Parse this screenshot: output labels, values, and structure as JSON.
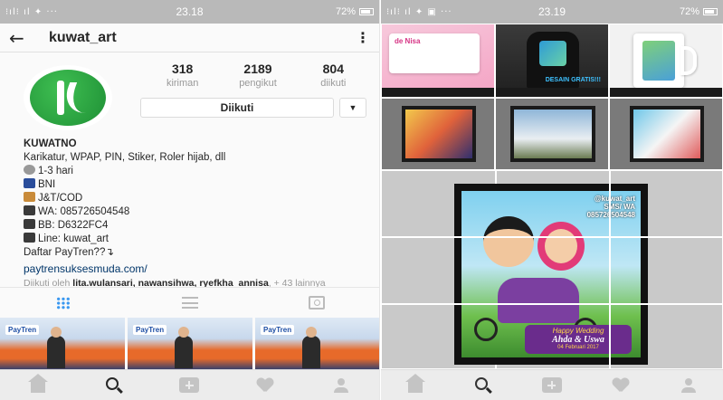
{
  "left": {
    "status": {
      "signal": "⁝ıl⁝ ıl ✦ ···",
      "time": "23.18",
      "battery": "72%"
    },
    "topbar": {
      "back": "←",
      "username": "kuwat_art",
      "menu": "⋮"
    },
    "stats": [
      {
        "value": "318",
        "label": "kiriman"
      },
      {
        "value": "2189",
        "label": "pengikut"
      },
      {
        "value": "804",
        "label": "diikuti"
      }
    ],
    "follow_button": "Diikuti",
    "dropdown": "▼",
    "bio": {
      "name": "KUWATNO",
      "desc": "Karikatur, WPAP, PIN, Stiker, Roler hijab, dll",
      "line1": "1-3 hari",
      "line2": "BNI",
      "line3": "J&T/COD",
      "line4": "WA: 085726504548",
      "line5": "BB: D6322FC4",
      "line6": "Line: kuwat_art",
      "line7": "Daftar PayTren??↴",
      "link": "paytrensuksesmuda.com/",
      "followed_prefix": "Diikuti oleh ",
      "followed_users": "lita.wulansari, nawansihwa, ryefkha_annisa",
      "followed_suffix": ", + 43 lainnya"
    },
    "thumb_brand": "PayTren"
  },
  "right": {
    "status": {
      "signal": "⁝ıl⁝ ıl ✦ ▣ ···",
      "time": "23.19",
      "battery": "72%"
    },
    "tiles": {
      "card_text": "de Nisa",
      "shirt_text": "DESAIN GRATIS!!!",
      "watermark_name": "@kuwat_art",
      "watermark_sub": "SMS/ WA",
      "watermark_phone": "085726504548",
      "banner_title": "Happy Wedding",
      "banner_names": "Ahda & Uswa",
      "banner_date": "04 Februari 2017"
    }
  }
}
